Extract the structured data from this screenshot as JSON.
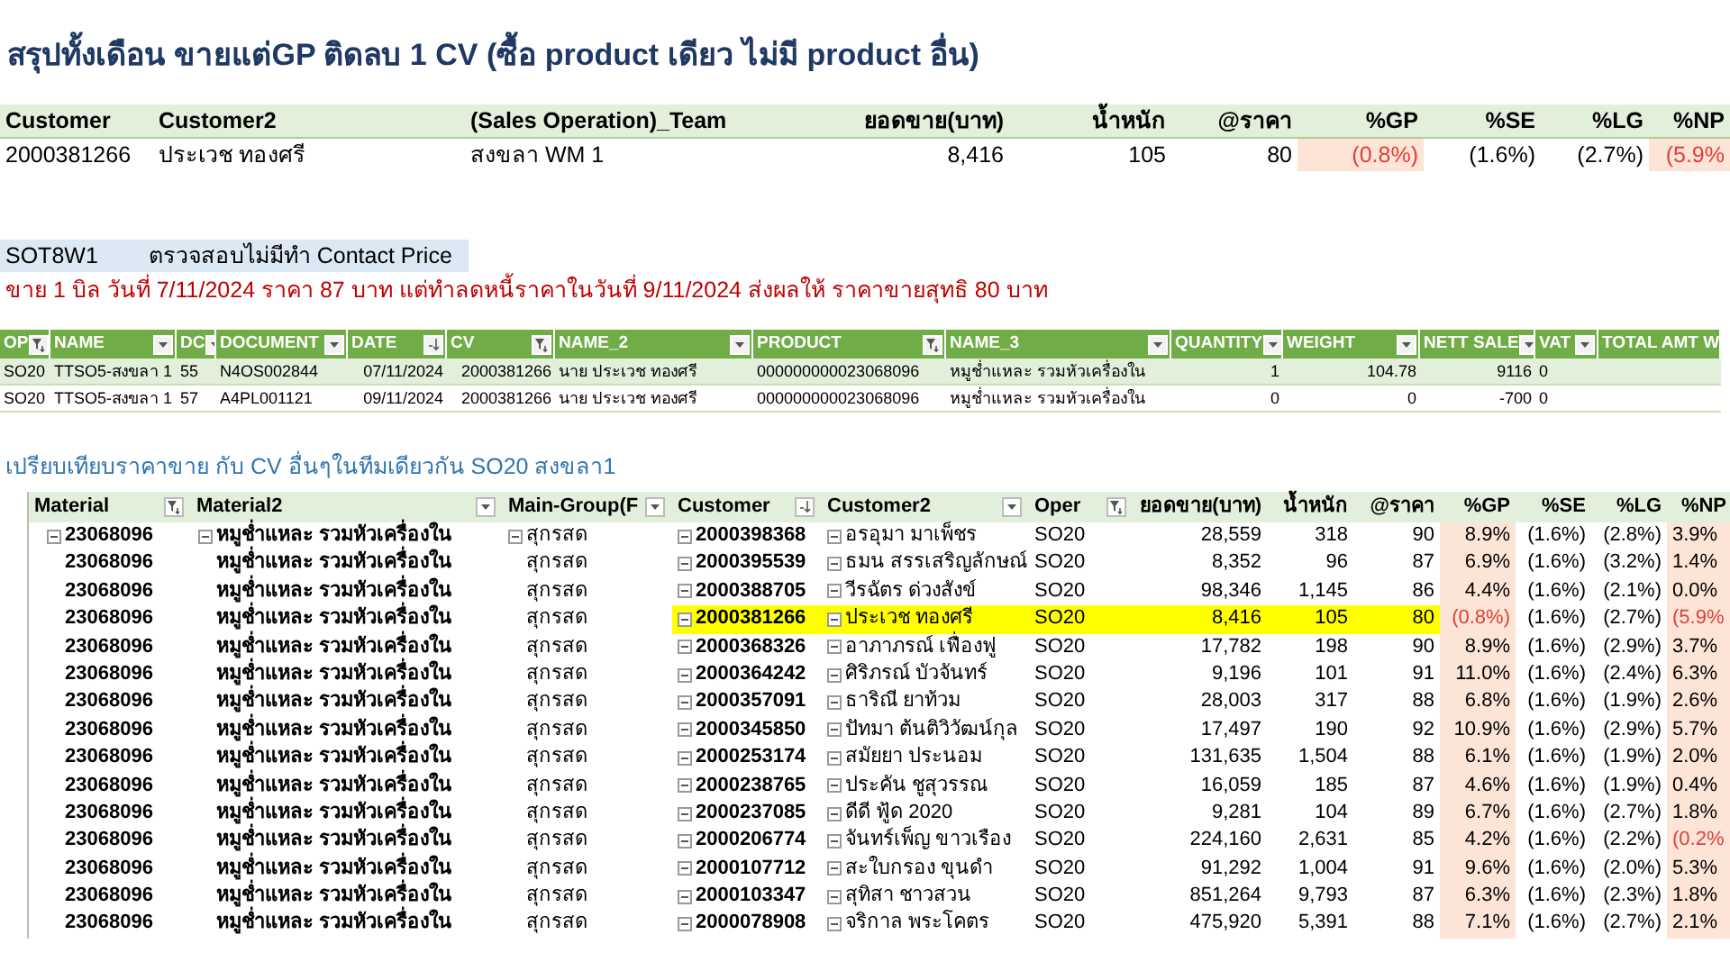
{
  "title": "สรุปทั้งเดือน ขายแต่GP ติดลบ 1 CV (ซื้อ product เดียว ไม่มี product อื่น)",
  "summary_table": {
    "columns": [
      "Customer",
      "Customer2",
      "(Sales Operation)_Team",
      "ยอดขาย(บาท)",
      "น้ำหนัก",
      "@ราคา",
      "%GP",
      "%SE",
      "%LG",
      "%NP"
    ],
    "row": [
      {
        "text": "2000381266",
        "negative": false
      },
      {
        "text": "ประเวช ทองศรี",
        "negative": false
      },
      {
        "text": "สงขลา WM 1",
        "negative": false
      },
      {
        "text": "8,416",
        "negative": false
      },
      {
        "text": "105",
        "negative": false
      },
      {
        "text": "80",
        "negative": false
      },
      {
        "text": "(0.8%)",
        "negative": true
      },
      {
        "text": "(1.6%)",
        "negative": false
      },
      {
        "text": "(2.7%)",
        "negative": false
      },
      {
        "text": "(5.9%",
        "negative": true
      }
    ]
  },
  "note": {
    "code": "SOT8W1",
    "text": "ตรวจสอบไม่มีทำ Contact Price"
  },
  "remark": "ขาย 1 บิล วันที่ 7/11/2024 ราคา 87 บาท แต่ทำลดหนี้ราคาในวันที่ 9/11/2024 ส่งผลให้ ราคาขายสุทธิ 80 บาท",
  "detail_table": {
    "columns": [
      {
        "label": "OP",
        "kind": "filter"
      },
      {
        "label": "NAME",
        "kind": "dropdown"
      },
      {
        "label": "DC",
        "kind": "dropdown"
      },
      {
        "label": "DOCUMENT",
        "kind": "dropdown"
      },
      {
        "label": "DATE",
        "kind": "sort"
      },
      {
        "label": "CV",
        "kind": "filter"
      },
      {
        "label": "NAME_2",
        "kind": "dropdown"
      },
      {
        "label": "PRODUCT",
        "kind": "filter"
      },
      {
        "label": "NAME_3",
        "kind": "dropdown"
      },
      {
        "label": "QUANTITY",
        "kind": "dropdown"
      },
      {
        "label": "WEIGHT",
        "kind": "dropdown"
      },
      {
        "label": "NETT SALE",
        "kind": "dropdown"
      },
      {
        "label": "VAT",
        "kind": "dropdown"
      },
      {
        "label": "TOTAL AMT W",
        "kind": "none"
      }
    ],
    "rows": [
      [
        "SO20",
        "TTSO5-สงขลา 1",
        "55",
        "N4OS002844",
        "07/11/2024",
        "2000381266",
        "นาย ประเวช ทองศรี",
        "000000000023068096",
        "หมูช่ำแหละ รวมหัวเครื่องใน",
        "1",
        "104.78",
        "9116",
        "0"
      ],
      [
        "SO20",
        "TTSO5-สงขลา 1",
        "57",
        "A4PL001121",
        "09/11/2024",
        "2000381266",
        "นาย ประเวช ทองศรี",
        "000000000023068096",
        "หมูช่ำแหละ รวมหัวเครื่องใน",
        "0",
        "0",
        "-700",
        "0"
      ]
    ]
  },
  "compare_title": "เปรียบเทียบราคาขาย กับ CV อื่นๆในทีมเดียวกัน SO20 สงขลา1",
  "pivot": {
    "columns": [
      {
        "label": "Material",
        "kind": "filter"
      },
      {
        "label": "Material2",
        "kind": "dropdown"
      },
      {
        "label": "Main-Group(F",
        "kind": "dropdown"
      },
      {
        "label": "Customer",
        "kind": "sort"
      },
      {
        "label": "Customer2",
        "kind": "dropdown"
      },
      {
        "label": "Oper",
        "kind": "filter"
      },
      {
        "label": "ยอดขาย(บาท)",
        "kind": "none"
      },
      {
        "label": "น้ำหนัก",
        "kind": "none"
      },
      {
        "label": "@ราคา",
        "kind": "none"
      },
      {
        "label": "%GP",
        "kind": "none"
      },
      {
        "label": "%SE",
        "kind": "none"
      },
      {
        "label": "%LG",
        "kind": "none"
      },
      {
        "label": "%NP",
        "kind": "none"
      }
    ],
    "rows": [
      {
        "material": "23068096",
        "material2": "หมูช่ำแหละ รวมหัวเครื่องใน",
        "main_group": "สุกรสด",
        "customer": "2000398368",
        "customer2": "อรอุมา มาเพ็ชร",
        "oper": "SO20",
        "sales": "28,559",
        "weight": "318",
        "price": "90",
        "gp": "8.9%",
        "se": "(1.6%)",
        "lg": "(2.8%)",
        "np": "3.9%",
        "group_header": true,
        "highlighted": false,
        "gp_negative": false,
        "np_negative": false
      },
      {
        "material": "23068096",
        "material2": "หมูช่ำแหละ รวมหัวเครื่องใน",
        "main_group": "สุกรสด",
        "customer": "2000395539",
        "customer2": "ธมน สรรเสริญลักษณ์",
        "oper": "SO20",
        "sales": "8,352",
        "weight": "96",
        "price": "87",
        "gp": "6.9%",
        "se": "(1.6%)",
        "lg": "(3.2%)",
        "np": "1.4%",
        "group_header": false,
        "highlighted": false,
        "gp_negative": false,
        "np_negative": false
      },
      {
        "material": "23068096",
        "material2": "หมูช่ำแหละ รวมหัวเครื่องใน",
        "main_group": "สุกรสด",
        "customer": "2000388705",
        "customer2": "วีรฉัตร ด่วงสังข์",
        "oper": "SO20",
        "sales": "98,346",
        "weight": "1,145",
        "price": "86",
        "gp": "4.4%",
        "se": "(1.6%)",
        "lg": "(2.1%)",
        "np": "0.0%",
        "group_header": false,
        "highlighted": false,
        "gp_negative": false,
        "np_negative": false
      },
      {
        "material": "23068096",
        "material2": "หมูช่ำแหละ รวมหัวเครื่องใน",
        "main_group": "สุกรสด",
        "customer": "2000381266",
        "customer2": "ประเวช ทองศรี",
        "oper": "SO20",
        "sales": "8,416",
        "weight": "105",
        "price": "80",
        "gp": "(0.8%)",
        "se": "(1.6%)",
        "lg": "(2.7%)",
        "np": "(5.9%",
        "group_header": false,
        "highlighted": true,
        "gp_negative": true,
        "np_negative": true
      },
      {
        "material": "23068096",
        "material2": "หมูช่ำแหละ รวมหัวเครื่องใน",
        "main_group": "สุกรสด",
        "customer": "2000368326",
        "customer2": "อาภาภรณ์ เฟื่องฟู",
        "oper": "SO20",
        "sales": "17,782",
        "weight": "198",
        "price": "90",
        "gp": "8.9%",
        "se": "(1.6%)",
        "lg": "(2.9%)",
        "np": "3.7%",
        "group_header": false,
        "highlighted": false,
        "gp_negative": false,
        "np_negative": false
      },
      {
        "material": "23068096",
        "material2": "หมูช่ำแหละ รวมหัวเครื่องใน",
        "main_group": "สุกรสด",
        "customer": "2000364242",
        "customer2": "ศิริภรณ์ บัวจันทร์",
        "oper": "SO20",
        "sales": "9,196",
        "weight": "101",
        "price": "91",
        "gp": "11.0%",
        "se": "(1.6%)",
        "lg": "(2.4%)",
        "np": "6.3%",
        "group_header": false,
        "highlighted": false,
        "gp_negative": false,
        "np_negative": false
      },
      {
        "material": "23068096",
        "material2": "หมูช่ำแหละ รวมหัวเครื่องใน",
        "main_group": "สุกรสด",
        "customer": "2000357091",
        "customer2": "ธาริณี ยาท้วม",
        "oper": "SO20",
        "sales": "28,003",
        "weight": "317",
        "price": "88",
        "gp": "6.8%",
        "se": "(1.6%)",
        "lg": "(1.9%)",
        "np": "2.6%",
        "group_header": false,
        "highlighted": false,
        "gp_negative": false,
        "np_negative": false
      },
      {
        "material": "23068096",
        "material2": "หมูช่ำแหละ รวมหัวเครื่องใน",
        "main_group": "สุกรสด",
        "customer": "2000345850",
        "customer2": "ปัทมา ต้นติวิวัฒน์กุล",
        "oper": "SO20",
        "sales": "17,497",
        "weight": "190",
        "price": "92",
        "gp": "10.9%",
        "se": "(1.6%)",
        "lg": "(2.9%)",
        "np": "5.7%",
        "group_header": false,
        "highlighted": false,
        "gp_negative": false,
        "np_negative": false
      },
      {
        "material": "23068096",
        "material2": "หมูช่ำแหละ รวมหัวเครื่องใน",
        "main_group": "สุกรสด",
        "customer": "2000253174",
        "customer2": "สมัยยา ประนอม",
        "oper": "SO20",
        "sales": "131,635",
        "weight": "1,504",
        "price": "88",
        "gp": "6.1%",
        "se": "(1.6%)",
        "lg": "(1.9%)",
        "np": "2.0%",
        "group_header": false,
        "highlighted": false,
        "gp_negative": false,
        "np_negative": false
      },
      {
        "material": "23068096",
        "material2": "หมูช่ำแหละ รวมหัวเครื่องใน",
        "main_group": "สุกรสด",
        "customer": "2000238765",
        "customer2": "ประคัน ชูสุวรรณ",
        "oper": "SO20",
        "sales": "16,059",
        "weight": "185",
        "price": "87",
        "gp": "4.6%",
        "se": "(1.6%)",
        "lg": "(1.9%)",
        "np": "0.4%",
        "group_header": false,
        "highlighted": false,
        "gp_negative": false,
        "np_negative": false
      },
      {
        "material": "23068096",
        "material2": "หมูช่ำแหละ รวมหัวเครื่องใน",
        "main_group": "สุกรสด",
        "customer": "2000237085",
        "customer2": "ดีดี ฟู้ด 2020",
        "oper": "SO20",
        "sales": "9,281",
        "weight": "104",
        "price": "89",
        "gp": "6.7%",
        "se": "(1.6%)",
        "lg": "(2.7%)",
        "np": "1.8%",
        "group_header": false,
        "highlighted": false,
        "gp_negative": false,
        "np_negative": false
      },
      {
        "material": "23068096",
        "material2": "หมูช่ำแหละ รวมหัวเครื่องใน",
        "main_group": "สุกรสด",
        "customer": "2000206774",
        "customer2": "จันทร์เพ็ญ ขาวเรือง",
        "oper": "SO20",
        "sales": "224,160",
        "weight": "2,631",
        "price": "85",
        "gp": "4.2%",
        "se": "(1.6%)",
        "lg": "(2.2%)",
        "np": "(0.2%",
        "group_header": false,
        "highlighted": false,
        "gp_negative": false,
        "np_negative": true
      },
      {
        "material": "23068096",
        "material2": "หมูช่ำแหละ รวมหัวเครื่องใน",
        "main_group": "สุกรสด",
        "customer": "2000107712",
        "customer2": "สะใบกรอง ขุนดำ",
        "oper": "SO20",
        "sales": "91,292",
        "weight": "1,004",
        "price": "91",
        "gp": "9.6%",
        "se": "(1.6%)",
        "lg": "(2.0%)",
        "np": "5.3%",
        "group_header": false,
        "highlighted": false,
        "gp_negative": false,
        "np_negative": false
      },
      {
        "material": "23068096",
        "material2": "หมูช่ำแหละ รวมหัวเครื่องใน",
        "main_group": "สุกรสด",
        "customer": "2000103347",
        "customer2": "สุทิสา ชาวสวน",
        "oper": "SO20",
        "sales": "851,264",
        "weight": "9,793",
        "price": "87",
        "gp": "6.3%",
        "se": "(1.6%)",
        "lg": "(2.3%)",
        "np": "1.8%",
        "group_header": false,
        "highlighted": false,
        "gp_negative": false,
        "np_negative": false
      },
      {
        "material": "23068096",
        "material2": "หมูช่ำแหละ รวมหัวเครื่องใน",
        "main_group": "สุกรสด",
        "customer": "2000078908",
        "customer2": "จริกาล พระโคตร",
        "oper": "SO20",
        "sales": "475,920",
        "weight": "5,391",
        "price": "88",
        "gp": "7.1%",
        "se": "(1.6%)",
        "lg": "(2.7%)",
        "np": "2.1%",
        "group_header": false,
        "highlighted": false,
        "gp_negative": false,
        "np_negative": false
      }
    ]
  }
}
